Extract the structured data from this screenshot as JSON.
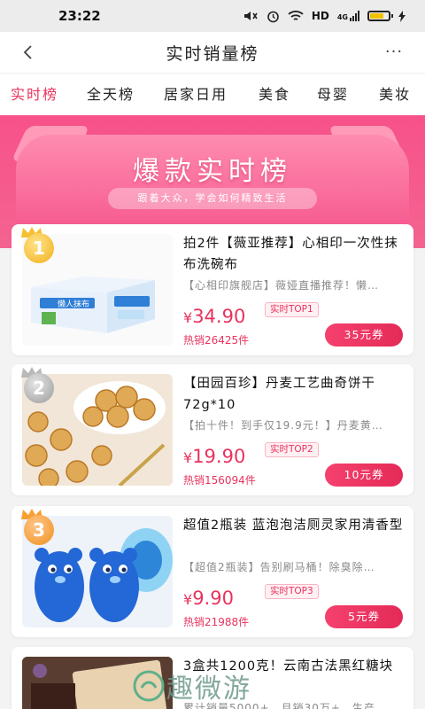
{
  "status_bar": {
    "time": "23:22",
    "network_label": "HD",
    "signal_label": "4G",
    "battery_level": 0.75,
    "battery_color": "#f2c200"
  },
  "nav": {
    "title": "实时销量榜",
    "back_icon": "chevron-left-icon",
    "more_icon": "more-dots-icon",
    "more_label": "···"
  },
  "tabs": [
    {
      "label": "实时榜",
      "active": true
    },
    {
      "label": "全天榜",
      "active": false
    },
    {
      "label": "居家日用",
      "active": false
    },
    {
      "label": "美食",
      "active": false
    },
    {
      "label": "母婴",
      "active": false
    },
    {
      "label": "美妆",
      "active": false
    }
  ],
  "banner": {
    "headline": "爆款实时榜",
    "tagline": "跟着大众，学会如何精致生活"
  },
  "products": [
    {
      "rank": "1",
      "title": "拍2件【薇亚推荐】心相印一次性抹布洗碗布",
      "desc": "【心相印旗舰店】薇娅直播推荐！懒…",
      "currency": "¥",
      "price": "34.90",
      "top_tag": "实时TOP1",
      "sold": "热销26425件",
      "coupon": "35元券"
    },
    {
      "rank": "2",
      "title": "【田园百珍】丹麦工艺曲奇饼干72g*10",
      "desc": "【拍十件！到手仅19.9元！】丹麦黄…",
      "currency": "¥",
      "price": "19.90",
      "top_tag": "实时TOP2",
      "sold": "热销156094件",
      "coupon": "10元券"
    },
    {
      "rank": "3",
      "title": "超值2瓶装 蓝泡泡洁厕灵家用清香型",
      "desc": "【超值2瓶装】告别刷马桶！除臭除…",
      "currency": "¥",
      "price": "9.90",
      "top_tag": "实时TOP3",
      "sold": "热销21988件",
      "coupon": "5元券"
    },
    {
      "title": "3盒共1200克！云南古法黑红糖块",
      "desc": "累计销量5000+，月销30万+，生产…"
    }
  ],
  "thumb_labels": {
    "product1_brand": "懒人抹布"
  },
  "watermark": {
    "text": "趣微游"
  },
  "colors": {
    "accent": "#e8335d",
    "banner": "#f7528a"
  }
}
